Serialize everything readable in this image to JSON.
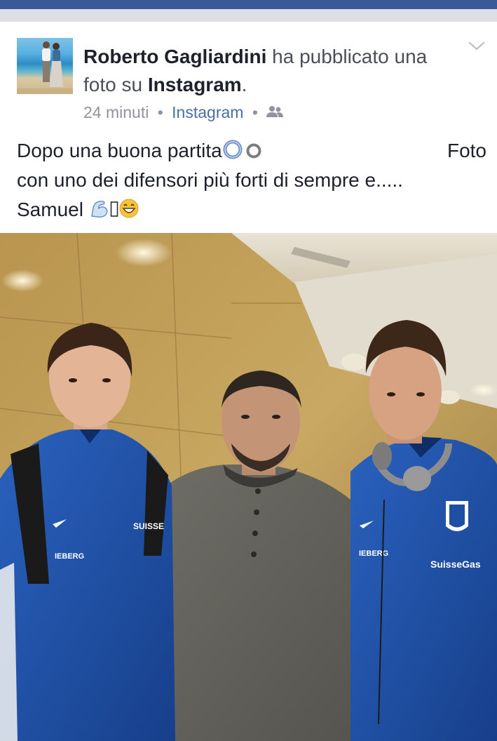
{
  "post": {
    "author": "Roberto Gagliardini",
    "action": "ha pubblicato una foto su",
    "platform": "Instagram",
    "period": ".",
    "time": "24 minuti",
    "source": "Instagram",
    "separator": "•",
    "audience_icon": "friends-icon",
    "menu_icon": "chevron-down-icon",
    "text_line1_left": "Dopo una buona partita",
    "text_line1_right": "Foto",
    "text_line2": "con uno dei difensori più forti di sempre e.....",
    "text_line3": "Samuel",
    "emoji_line1": [
      "blue-ring-emoji",
      "grey-ring-emoji"
    ],
    "emoji_line3": [
      "flexed-biceps-emoji",
      "missing-glyph",
      "grinning-face-emoji"
    ]
  },
  "photo_text": {
    "jersey_right_sponsor": "SuisseGas",
    "jersey_left_sponsor": "SUISSE",
    "jersey_sleeve_left": "IEBERG",
    "jersey_sleeve_right": "IEBERG"
  },
  "colors": {
    "topbar": "#3b5998",
    "link": "#4b6ea8",
    "meta": "#90949c",
    "jersey": "#1d4fa3"
  }
}
